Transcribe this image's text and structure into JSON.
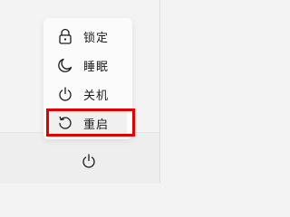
{
  "power_menu": {
    "items": [
      {
        "label": "锁定",
        "icon": "lock-icon"
      },
      {
        "label": "睡眠",
        "icon": "moon-icon"
      },
      {
        "label": "关机",
        "icon": "power-icon"
      },
      {
        "label": "重启",
        "icon": "restart-icon"
      }
    ],
    "highlighted_item": "重启"
  },
  "taskbar": {
    "power_button_icon": "power-icon"
  },
  "colors": {
    "menu_bg": "#fbfbfb",
    "page_bg": "#f3f3f3",
    "highlight_border": "#e00000",
    "text": "#1b1b1b",
    "icon_stroke": "#1b1b1b"
  }
}
